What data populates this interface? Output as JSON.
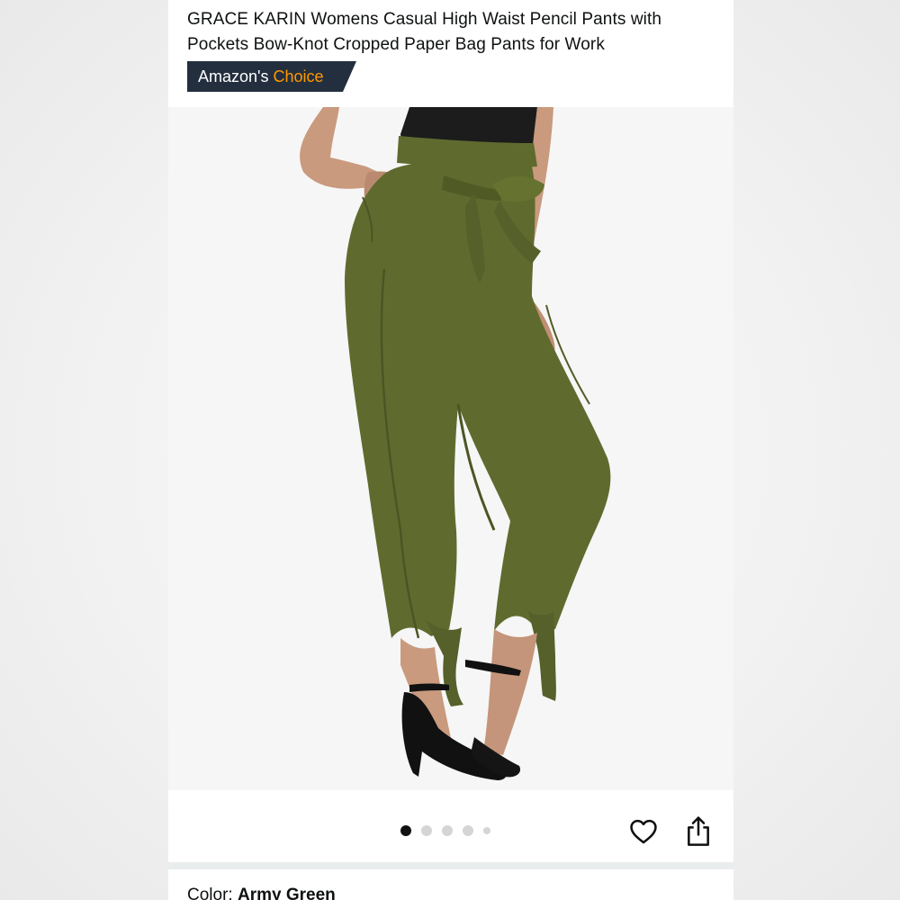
{
  "product": {
    "title_line1": "GRACE KARIN Womens Casual High Waist Pencil Pants with",
    "title_line2": "Pockets Bow-Knot Cropped Paper Bag Pants for Work"
  },
  "badge": {
    "prefix": "Amazon's",
    "highlight": "Choice",
    "bg_color": "#232f3e",
    "highlight_color": "#ff9900"
  },
  "gallery": {
    "image_alt": "Woman wearing olive green high waist paper bag pants with bow-knot belt and tie ankle cuffs, black strappy heels",
    "dot_count": 5,
    "active_index": 0,
    "pants_color": "#5f6b2e"
  },
  "actions": {
    "wishlist_icon": "heart-icon",
    "share_icon": "share-icon"
  },
  "variation": {
    "label": "Color:",
    "value": "Army Green"
  }
}
